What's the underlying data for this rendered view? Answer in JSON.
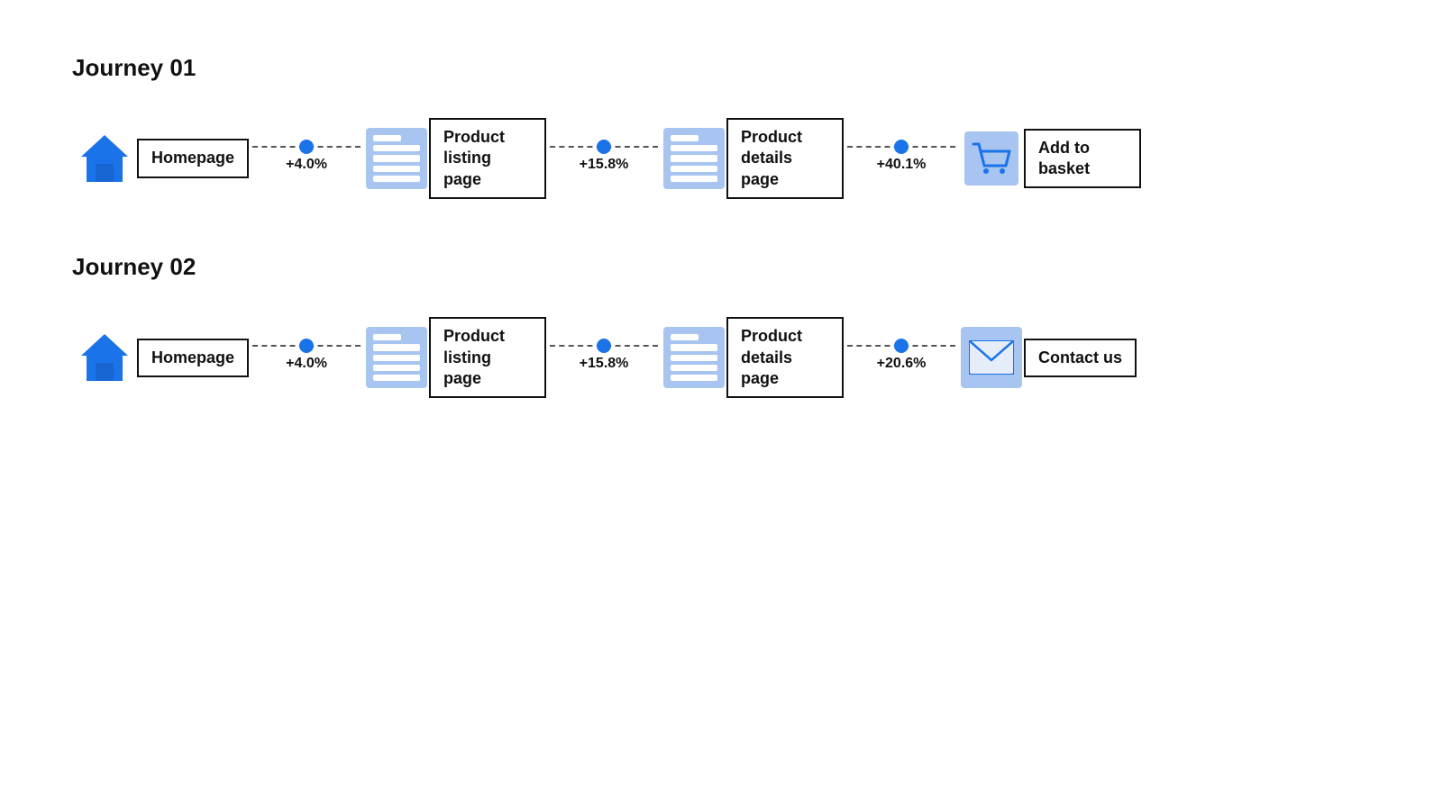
{
  "journeys": [
    {
      "id": "journey-01",
      "title": "Journey 01",
      "steps": [
        {
          "id": "homepage-1",
          "icon": "house",
          "label": "Homepage",
          "multiline": false
        },
        {
          "id": "product-listing-1",
          "icon": "page",
          "label": "Product listing page",
          "multiline": true
        },
        {
          "id": "product-details-1",
          "icon": "page",
          "label": "Product details page",
          "multiline": true
        },
        {
          "id": "add-basket-1",
          "icon": "cart",
          "label": "Add to basket",
          "multiline": true
        }
      ],
      "connectors": [
        {
          "id": "c1-1",
          "pct": "+4.0%"
        },
        {
          "id": "c1-2",
          "pct": "+15.8%"
        },
        {
          "id": "c1-3",
          "pct": "+40.1%"
        }
      ]
    },
    {
      "id": "journey-02",
      "title": "Journey 02",
      "steps": [
        {
          "id": "homepage-2",
          "icon": "house",
          "label": "Homepage",
          "multiline": false
        },
        {
          "id": "product-listing-2",
          "icon": "page",
          "label": "Product listing page",
          "multiline": true
        },
        {
          "id": "product-details-2",
          "icon": "page",
          "label": "Product details page",
          "multiline": true
        },
        {
          "id": "contact-us-2",
          "icon": "envelope",
          "label": "Contact us",
          "multiline": true
        }
      ],
      "connectors": [
        {
          "id": "c2-1",
          "pct": "+4.0%"
        },
        {
          "id": "c2-2",
          "pct": "+15.8%"
        },
        {
          "id": "c2-3",
          "pct": "+20.6%"
        }
      ]
    }
  ]
}
